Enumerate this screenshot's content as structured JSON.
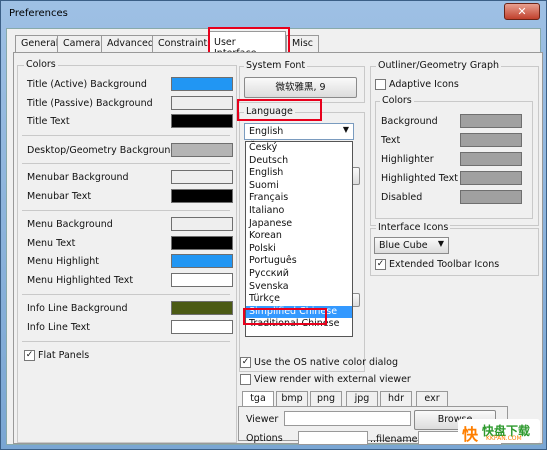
{
  "window": {
    "title": "Preferences",
    "close_glyph": "✕"
  },
  "tabs": [
    {
      "label": "General"
    },
    {
      "label": "Camera"
    },
    {
      "label": "Advanced"
    },
    {
      "label": "Constraints"
    },
    {
      "label": "User Interface"
    },
    {
      "label": "Misc"
    }
  ],
  "colors_group": {
    "title": "Colors",
    "rows": [
      {
        "label": "Title (Active) Background",
        "color": "#2196f3"
      },
      {
        "label": "Title (Passive) Background",
        "color": "#eeeeee"
      },
      {
        "label": "Title Text",
        "color": "#000000"
      },
      {
        "label": "Desktop/Geometry Background",
        "color": "#b4b4b4"
      },
      {
        "label": "Menubar Background",
        "color": "#eeeeee"
      },
      {
        "label": "Menubar Text",
        "color": "#000000"
      },
      {
        "label": "Menu Background",
        "color": "#eeeeee"
      },
      {
        "label": "Menu Text",
        "color": "#000000"
      },
      {
        "label": "Menu Highlight",
        "color": "#2196f3"
      },
      {
        "label": "Menu Highlighted Text",
        "color": "#ffffff"
      },
      {
        "label": "Info Line Background",
        "color": "#4b5a14"
      },
      {
        "label": "Info Line Text",
        "color": "#ffffff"
      }
    ],
    "flat_panels": {
      "label": "Flat Panels",
      "checked": true
    }
  },
  "system_font": {
    "title": "System Font",
    "button": "微软雅黑, 9"
  },
  "language": {
    "title": "Language",
    "selected": "English",
    "options": [
      "Český",
      "Deutsch",
      "English",
      "Suomi",
      "Français",
      "Italiano",
      "Japanese",
      "Korean",
      "Polski",
      "Português",
      "Русский",
      "Svenska",
      "Türkçe",
      "Simplified Chinese",
      "Traditional Chinese"
    ],
    "highlighted": "Simplified Chinese"
  },
  "native_color": {
    "label": "Use the OS native color dialog",
    "checked": true
  },
  "external_viewer": {
    "label": "View render with external viewer",
    "checked": false
  },
  "outliner": {
    "title": "Outliner/Geometry Graph",
    "adaptive_icons": {
      "label": "Adaptive Icons",
      "checked": false
    },
    "colors_title": "Colors",
    "rows": [
      {
        "label": "Background",
        "color": "#a0a0a0"
      },
      {
        "label": "Text",
        "color": "#a0a0a0"
      },
      {
        "label": "Highlighter",
        "color": "#a0a0a0"
      },
      {
        "label": "Highlighted Text",
        "color": "#a0a0a0"
      },
      {
        "label": "Disabled",
        "color": "#a0a0a0"
      }
    ]
  },
  "interface_icons": {
    "title": "Interface Icons",
    "selected": "Blue Cube",
    "extended_toolbar": {
      "label": "Extended Toolbar Icons",
      "checked": true
    }
  },
  "render_tabs": [
    "tga",
    "bmp",
    "png",
    "jpg",
    "hdr",
    "exr"
  ],
  "render": {
    "viewer_label": "Viewer",
    "browse_label": "Browse",
    "options_label": "Options",
    "filename_label": "..filename.."
  },
  "watermark": {
    "mark": "快",
    "text": "快盘下载",
    "url": "KKPAN.COM"
  }
}
